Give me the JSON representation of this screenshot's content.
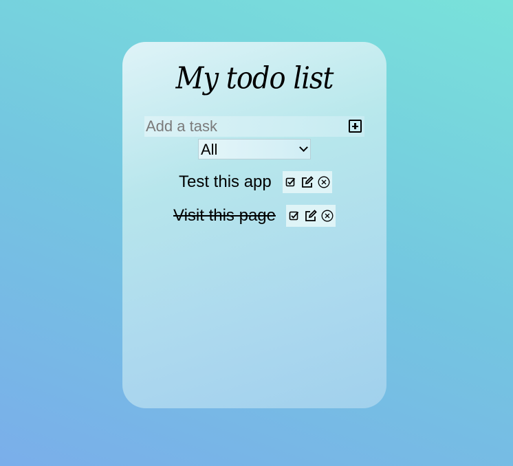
{
  "app": {
    "title": "My todo list"
  },
  "add_task": {
    "placeholder": "Add a task",
    "value": "",
    "button_icon": "plus-square-icon"
  },
  "filter": {
    "selected": "All"
  },
  "tasks": [
    {
      "label": "Test this app",
      "completed": false,
      "actions": [
        "check-square-icon",
        "edit-icon",
        "delete-circle-icon"
      ]
    },
    {
      "label": "Visit this page",
      "completed": true,
      "actions": [
        "check-square-icon",
        "edit-icon",
        "delete-circle-icon"
      ]
    }
  ]
}
